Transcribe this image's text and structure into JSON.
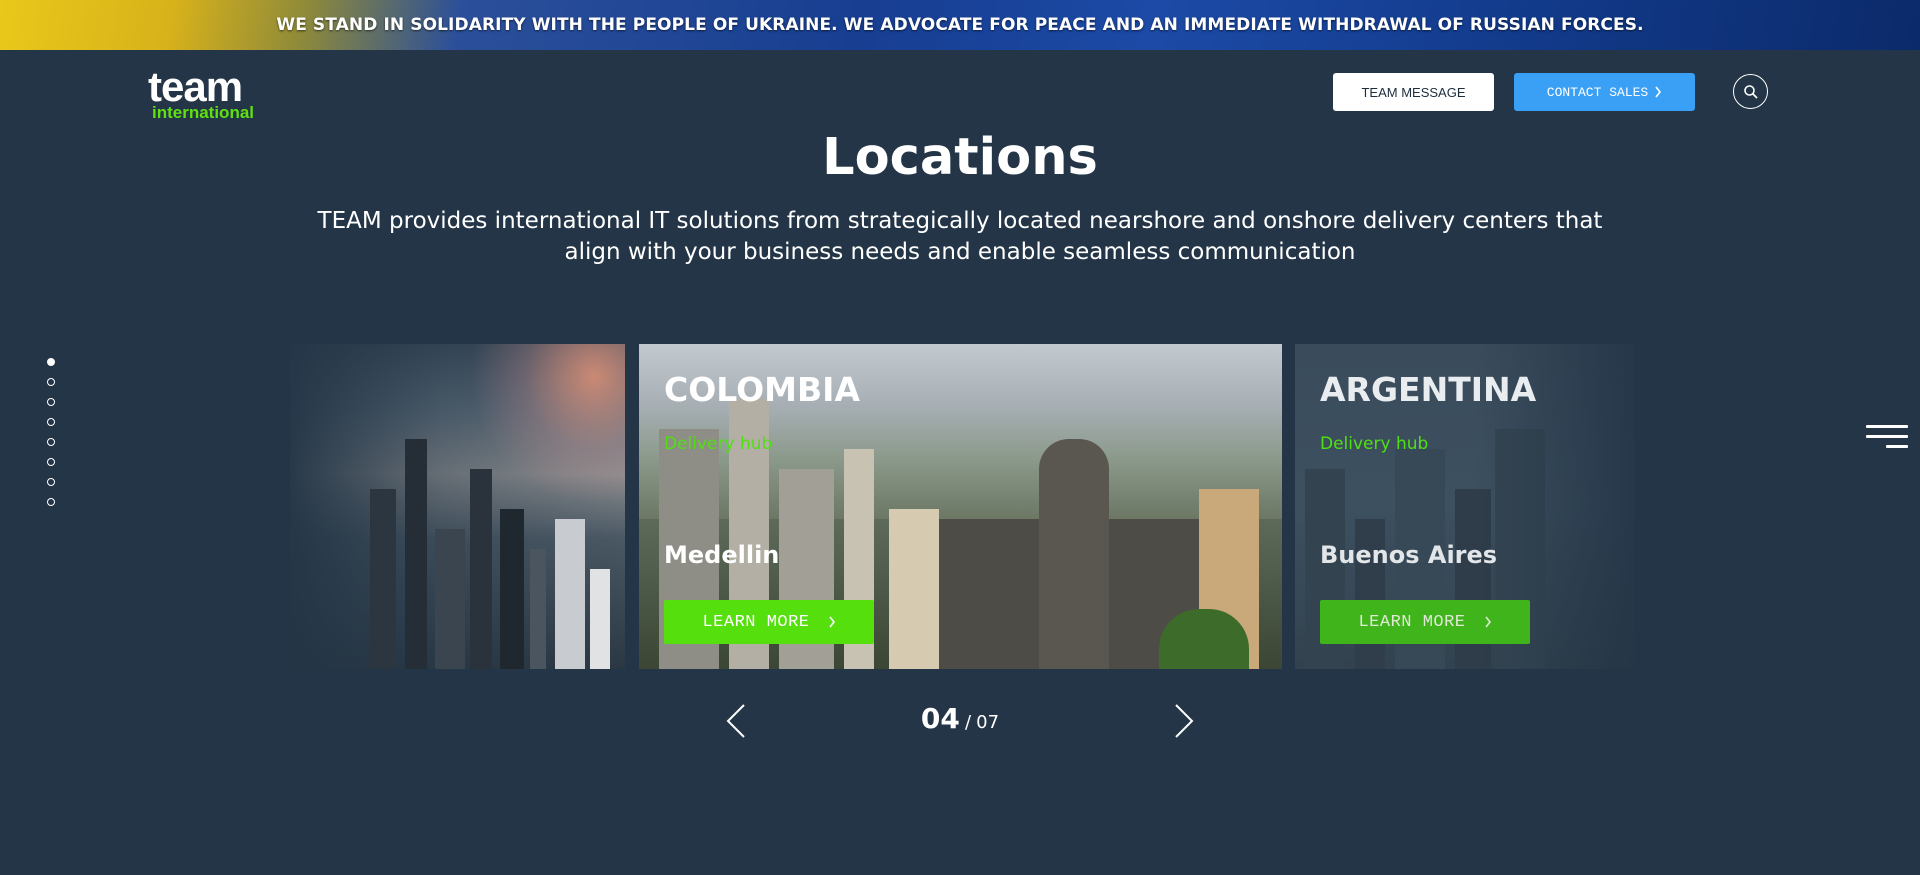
{
  "banner": {
    "text": "WE STAND IN SOLIDARITY WITH THE PEOPLE OF UKRAINE. WE ADVOCATE FOR PEACE AND AN IMMEDIATE WITHDRAWAL OF RUSSIAN FORCES."
  },
  "header": {
    "logo_line1": "team",
    "logo_line2": "international",
    "team_message_label": "TEAM MESSAGE",
    "contact_sales_label": "CONTACT SALES",
    "search_icon": "search-icon"
  },
  "main": {
    "title": "Locations",
    "subtitle": "TEAM provides international IT solutions from strategically located nearshore and onshore delivery centers that align with your business needs and enable seamless communication"
  },
  "carousel": {
    "slides": [
      {
        "country": "COLOMBIA",
        "hub": "Delivery hub",
        "city": "Medellin",
        "button": "LEARN MORE"
      },
      {
        "country": "ARGENTINA",
        "hub": "Delivery hub",
        "city": "Buenos Aires",
        "button": "LEARN MORE"
      }
    ],
    "current": "04",
    "separator": "/",
    "total": "07"
  },
  "side_dots": {
    "count": 8,
    "active_index": 0
  },
  "colors": {
    "background": "#233546",
    "accent_green": "#55e00e",
    "accent_blue": "#3aa0f5"
  }
}
